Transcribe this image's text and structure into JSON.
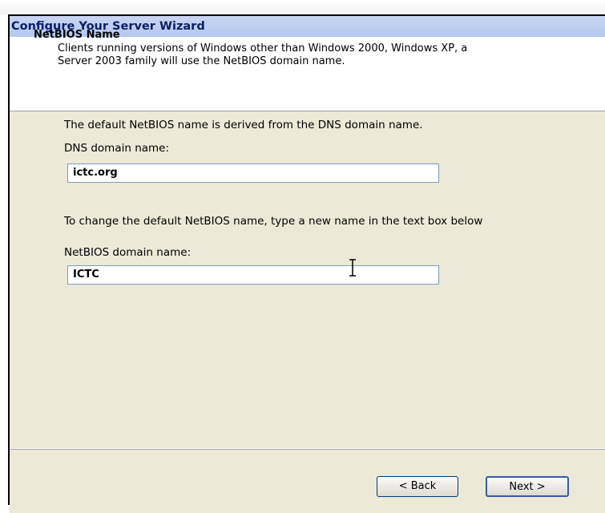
{
  "window": {
    "title": "Configure Your Server Wizard"
  },
  "header": {
    "title": "NetBIOS Name",
    "description": "Clients running versions of Windows other than Windows 2000, Windows XP, a\nServer 2003 family will use the NetBIOS domain name."
  },
  "body": {
    "intro_text": "The default NetBIOS name is derived from the DNS domain name.",
    "dns_label": "DNS domain name:",
    "dns_value": "ictc.org",
    "change_text": "To change the default NetBIOS name, type a new name in the text box below",
    "netbios_label": "NetBIOS domain name:",
    "netbios_value": "ICTC"
  },
  "buttons": {
    "back_label": "< Back",
    "next_label": "Next >"
  },
  "colors": {
    "title_bar": "#b4c8ef",
    "title_text": "#0a1e64",
    "dialog_background": "#ece9d8",
    "input_border": "#7f9db9"
  },
  "icons": {
    "text_cursor": "i-beam-cursor-icon"
  }
}
